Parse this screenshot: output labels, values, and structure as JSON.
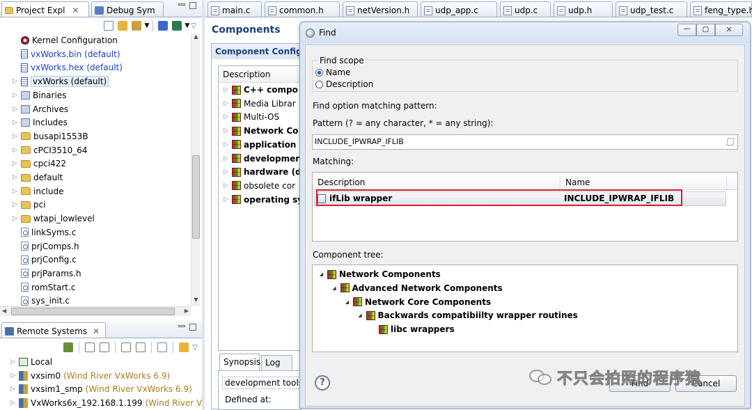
{
  "left_tabs": {
    "project": "Project Expl",
    "debug": "Debug Sym"
  },
  "project_tree": [
    {
      "label": "Kernel Configuration",
      "icon": "kernel-config-icon",
      "arrow": "",
      "indent": 0,
      "link": false
    },
    {
      "label": "vxWorks.bin (default)",
      "icon": "image-file-icon",
      "arrow": "",
      "indent": 0,
      "link": true
    },
    {
      "label": "vxWorks.hex (default)",
      "icon": "image-file-icon",
      "arrow": "",
      "indent": 0,
      "link": true
    },
    {
      "label": "vxWorks (default)",
      "icon": "image-file-icon",
      "arrow": "▷",
      "indent": 0,
      "link": false,
      "selected": true
    },
    {
      "label": "Binaries",
      "icon": "binaries-icon",
      "arrow": "▷",
      "indent": 0
    },
    {
      "label": "Archives",
      "icon": "archives-icon",
      "arrow": "▷",
      "indent": 0
    },
    {
      "label": "Includes",
      "icon": "includes-icon",
      "arrow": "▷",
      "indent": 0
    },
    {
      "label": "busapi1553B",
      "icon": "folder-icon",
      "arrow": "▷",
      "indent": 0
    },
    {
      "label": "cPCI3510_64",
      "icon": "folder-icon",
      "arrow": "▷",
      "indent": 0
    },
    {
      "label": "cpci422",
      "icon": "folder-icon",
      "arrow": "▷",
      "indent": 0
    },
    {
      "label": "default",
      "icon": "folder-icon",
      "arrow": "▷",
      "indent": 0
    },
    {
      "label": "include",
      "icon": "folder-icon",
      "arrow": "▷",
      "indent": 0
    },
    {
      "label": "pci",
      "icon": "folder-icon",
      "arrow": "▷",
      "indent": 0
    },
    {
      "label": "wtapi_lowlevel",
      "icon": "folder-icon",
      "arrow": "▷",
      "indent": 0
    },
    {
      "label": "linkSyms.c",
      "icon": "c-file-icon",
      "arrow": "",
      "indent": 0
    },
    {
      "label": "prjComps.h",
      "icon": "h-file-icon",
      "arrow": "",
      "indent": 0
    },
    {
      "label": "prjConfig.c",
      "icon": "c-file-icon",
      "arrow": "",
      "indent": 0
    },
    {
      "label": "prjParams.h",
      "icon": "h-file-icon",
      "arrow": "",
      "indent": 0
    },
    {
      "label": "romStart.c",
      "icon": "c-file-icon",
      "arrow": "",
      "indent": 0
    },
    {
      "label": "sys_init.c",
      "icon": "c-file-icon",
      "arrow": "",
      "indent": 0
    }
  ],
  "remote": {
    "title": "Remote Systems",
    "items": [
      {
        "name": "Local",
        "extra": ""
      },
      {
        "name": "vxsim0",
        "extra": "(Wind River VxWorks 6.9)"
      },
      {
        "name": "vxsim1_smp",
        "extra": "(Wind River VxWorks 6.9)"
      },
      {
        "name": "VxWorks6x_192.168.1.199",
        "extra": "(Wind River VxW"
      }
    ]
  },
  "editor_tabs": [
    "main.c",
    "common.h",
    "netVersion.h",
    "udp_app.c",
    "udp.c",
    "udp.h",
    "udp_test.c",
    "feng_type.h"
  ],
  "components": {
    "title": "Components",
    "subtitle": "Component Configu",
    "column": "Description",
    "items": [
      {
        "label": "C++ compo",
        "bold": true
      },
      {
        "label": "Media Librar",
        "bold": false
      },
      {
        "label": "Multi-OS",
        "bold": false
      },
      {
        "label": "Network Co",
        "bold": true
      },
      {
        "label": "application",
        "bold": true
      },
      {
        "label": "developmer",
        "bold": true
      },
      {
        "label": "hardware (d",
        "bold": true
      },
      {
        "label": "obsolete cor",
        "bold": false
      },
      {
        "label": "operating sy",
        "bold": true
      }
    ],
    "bottom_tabs": [
      "Synopsis",
      "Log"
    ],
    "synopsis_text": "development tools",
    "defined_at": "Defined at:"
  },
  "dialog": {
    "title": "Find",
    "scope_legend": "Find scope",
    "scope_name": "Name",
    "scope_desc": "Description",
    "option_label": "Find option matching pattern:",
    "pattern_label": "Pattern (? = any character, * = any string):",
    "pattern_value": "INCLUDE_IPWRAP_IFLIB",
    "matching_label": "Matching:",
    "match_headers": [
      "Description",
      "Name"
    ],
    "match_row": {
      "description": "ifLib wrapper",
      "name": "INCLUDE_IPWRAP_IFLIB"
    },
    "tree_label": "Component tree:",
    "tree": [
      {
        "label": "Network Components",
        "level": 0
      },
      {
        "label": "Advanced Network Components",
        "level": 1
      },
      {
        "label": "Network Core Components",
        "level": 2
      },
      {
        "label": "Backwards compatibiilty wrapper routines",
        "level": 3
      },
      {
        "label": "libc wrappers",
        "level": 4
      }
    ],
    "find_btn": "Find",
    "cancel_btn": "Cancel",
    "help": "?"
  },
  "watermark": "不只会拍照的程序猿",
  "colors": {
    "link": "#1a3ccd",
    "highlight": "#e0192a",
    "title_blue": "#1f3f7c",
    "remote_extra": "#b07a1c"
  }
}
